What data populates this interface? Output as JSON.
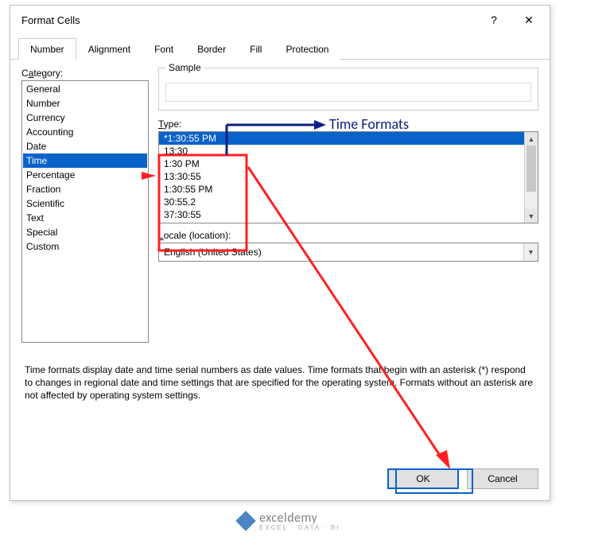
{
  "dialog": {
    "title": "Format Cells",
    "help": "?",
    "close": "✕"
  },
  "tabs": {
    "items": [
      {
        "label": "Number"
      },
      {
        "label": "Alignment"
      },
      {
        "label": "Font"
      },
      {
        "label": "Border"
      },
      {
        "label": "Fill"
      },
      {
        "label": "Protection"
      }
    ]
  },
  "category": {
    "label_pre": "C",
    "label_ul": "a",
    "label_post": "tegory:",
    "items": [
      "General",
      "Number",
      "Currency",
      "Accounting",
      "Date",
      "Time",
      "Percentage",
      "Fraction",
      "Scientific",
      "Text",
      "Special",
      "Custom"
    ],
    "selected": "Time"
  },
  "sample": {
    "legend": "Sample"
  },
  "type": {
    "label_ul": "T",
    "label_post": "ype:",
    "items": [
      "*1:30:55 PM",
      "13:30",
      "1:30 PM",
      "13:30:55",
      "1:30:55 PM",
      "30:55.2",
      "37:30:55"
    ],
    "selected": "*1:30:55 PM"
  },
  "locale": {
    "label_ul": "L",
    "label_post": "ocale (location):",
    "value": "English (United States)"
  },
  "description": "Time formats display date and time serial numbers as date values. Time formats that begin with an asterisk (*) respond to changes in regional date and time settings that are specified for the operating system. Formats without an asterisk are not affected by operating system settings.",
  "buttons": {
    "ok": "OK",
    "cancel": "Cancel"
  },
  "annotation": {
    "title": "Time Formats"
  },
  "branding": {
    "name": "exceldemy",
    "tagline": "EXCEL · DATA · BI"
  }
}
